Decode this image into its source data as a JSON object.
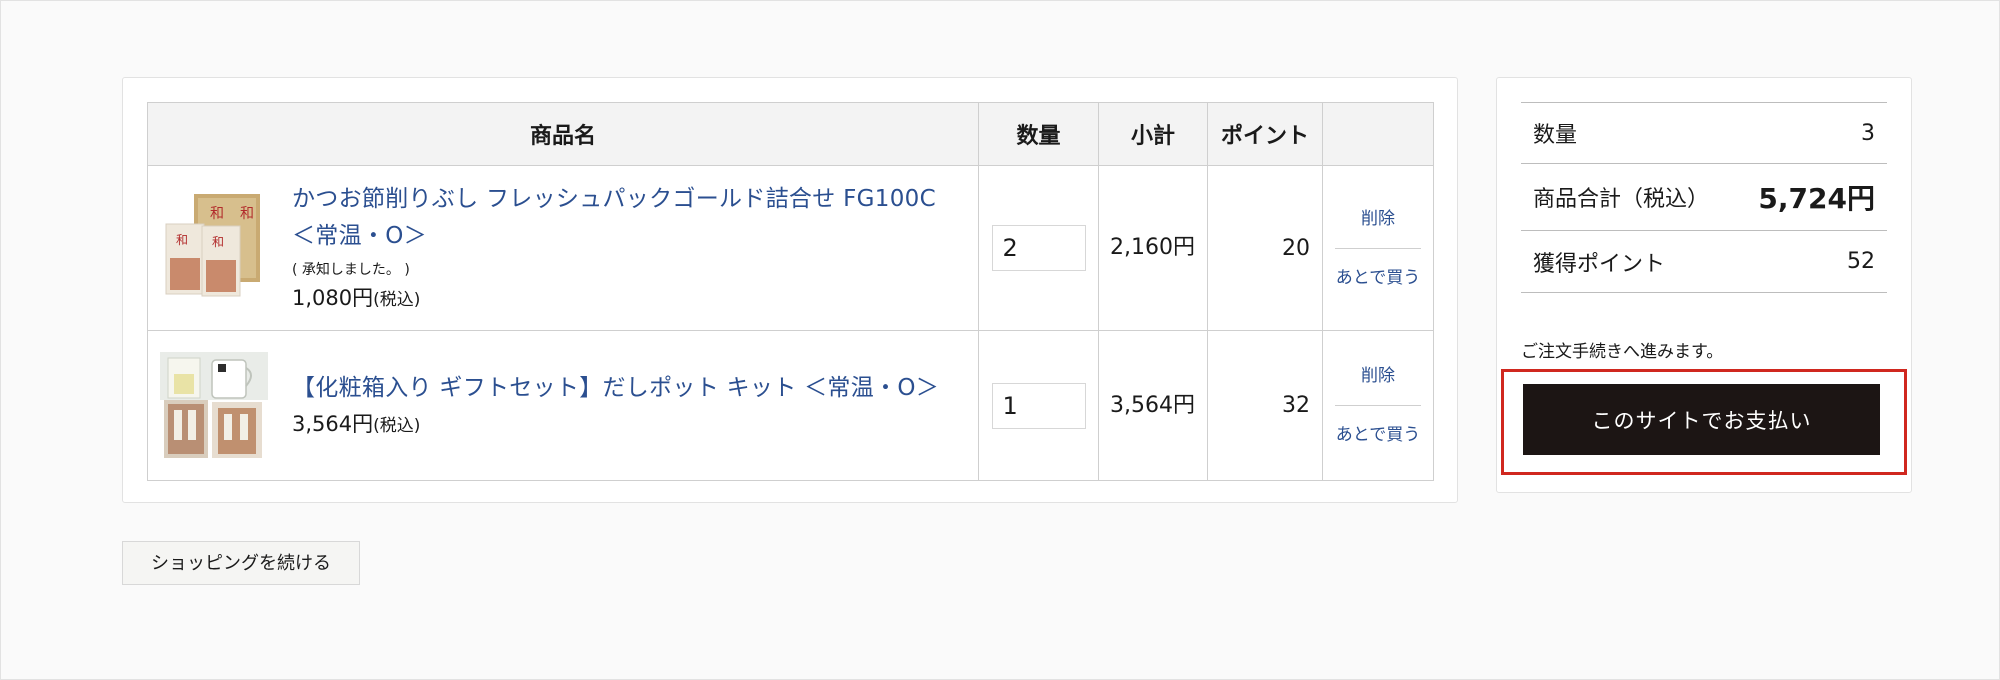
{
  "cart": {
    "headers": {
      "product": "商品名",
      "quantity": "数量",
      "subtotal": "小計",
      "points": "ポイント",
      "actions": ""
    },
    "items": [
      {
        "name": "かつお節削りぶし フレッシュパックゴールド詰合せ FG100C ＜常温・O＞",
        "note": "( 承知しました。 )",
        "price": "1,080円",
        "tax_label": "(税込)",
        "quantity": "2",
        "subtotal": "2,160円",
        "points": "20",
        "delete_label": "削除",
        "later_label": "あとで買う"
      },
      {
        "name": "【化粧箱入り ギフトセット】だしポット キット ＜常温・O＞",
        "note": "",
        "price": "3,564円",
        "tax_label": "(税込)",
        "quantity": "1",
        "subtotal": "3,564円",
        "points": "32",
        "delete_label": "削除",
        "later_label": "あとで買う"
      }
    ]
  },
  "continue_shopping_label": "ショッピングを続ける",
  "summary": {
    "quantity_label": "数量",
    "quantity_value": "3",
    "total_label": "商品合計（税込）",
    "total_value": "5,724円",
    "points_label": "獲得ポイント",
    "points_value": "52",
    "checkout_note": "ご注文手続きへ進みます。",
    "pay_button_label": "このサイトでお支払い"
  },
  "colors": {
    "link": "#2b4f90",
    "pay_button_bg": "#1c1514",
    "highlight_border": "#d0281f"
  },
  "icons": {
    "item1_thumbnail": "katsuobushi-gift-box-image",
    "item2_thumbnail": "dashi-pot-kit-image"
  }
}
